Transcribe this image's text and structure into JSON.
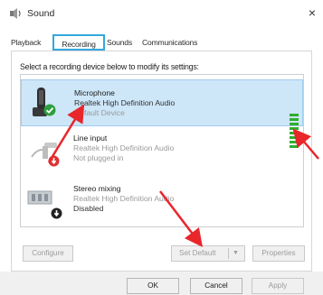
{
  "window": {
    "title": "Sound",
    "close_glyph": "×",
    "title_icon": "speaker-icon",
    "close_icon": "close-icon"
  },
  "tabs": [
    {
      "label": "Playback",
      "selected": false
    },
    {
      "label": "Recording",
      "selected": true
    },
    {
      "label": "Sounds",
      "selected": false
    },
    {
      "label": "Communications",
      "selected": false
    }
  ],
  "instruction": "Select a recording device below to modify its settings:",
  "devices": [
    {
      "name": "Microphone",
      "driver": "Realtek High Definition Audio",
      "status": "Default Device",
      "icon": "microphone-icon",
      "badge": "default-check-icon",
      "selected": true,
      "level_bars_lit": 8
    },
    {
      "name": "Line input",
      "driver": "Realtek High Definition Audio",
      "status": "Not plugged in",
      "icon": "line-input-icon",
      "badge": "unplugged-icon",
      "selected": false
    },
    {
      "name": "Stereo mixing",
      "driver": "Realtek High Definition Audio",
      "status": "Disabled",
      "icon": "stereo-mix-icon",
      "badge": "disabled-icon",
      "selected": false
    }
  ],
  "buttons": {
    "configure": "Configure",
    "set_default": "Set Default",
    "set_default_caret": "▼",
    "properties": "Properties",
    "ok": "OK",
    "cancel": "Cancel",
    "apply": "Apply"
  },
  "colors": {
    "highlight_tab_border": "#33a7dc",
    "selected_row": "#cde6f8",
    "level_meter": "#2fae2f",
    "annotation_arrow": "#e8262b"
  }
}
